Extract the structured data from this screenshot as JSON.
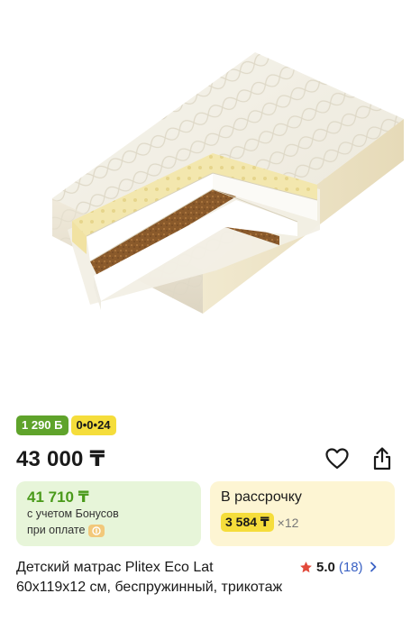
{
  "product": {
    "image_alt": "Детский матрас Plitex Eco Lat",
    "badges": {
      "bonus": "1 290 Б",
      "installment": "0•0•24"
    },
    "price": "43 000 ₸",
    "bonus_card": {
      "price": "41 710 ₸",
      "line1": "с учетом Бонусов",
      "line2": "при оплате"
    },
    "installment_card": {
      "title": "В рассрочку",
      "monthly": "3 584 ₸",
      "multiplier": "×12"
    },
    "title": "Детский матрас Plitex Eco Lat 60x119x12 см, беспружинный, трикотаж",
    "rating": {
      "value": "5.0",
      "count": "(18)"
    }
  },
  "icons": {
    "favorite": "heart-icon",
    "share": "share-icon",
    "rating": "star-icon",
    "chevron": "chevron-right-icon",
    "coin": "coin-icon"
  },
  "colors": {
    "bonus_green": "#5fa32b",
    "installment_yellow": "#f5dd3b",
    "green_card": "#e7f5d9",
    "yellow_card": "#fdf5d3",
    "star_red": "#e24a3b",
    "link_blue": "#3b62c4"
  }
}
